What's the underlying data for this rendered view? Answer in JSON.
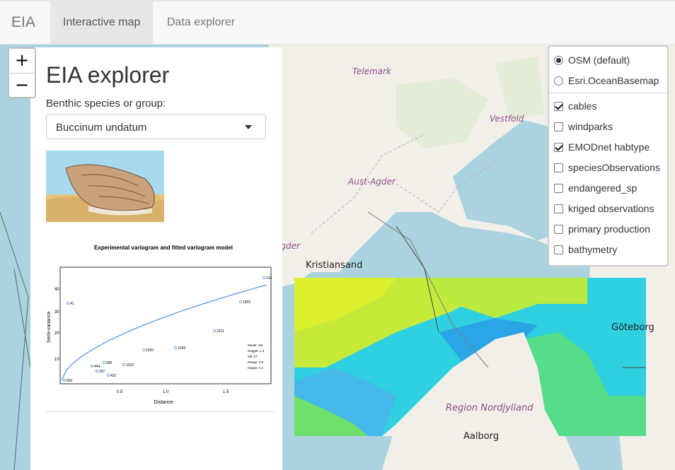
{
  "navbar": {
    "brand": "EIA",
    "tabs": [
      {
        "label": "Interactive map",
        "active": true
      },
      {
        "label": "Data explorer",
        "active": false
      }
    ]
  },
  "zoom": {
    "in": "+",
    "out": "−"
  },
  "panel": {
    "title": "EIA explorer",
    "species_label": "Benthic species or group:",
    "species_selected": "Buccinum undatum"
  },
  "variogram": {
    "title": "Experimental variogram and fitted variogram model",
    "xlabel": "Distance",
    "ylabel": "Semi-variance",
    "x_ticks": [
      "0.5",
      "1.0",
      "1.5"
    ],
    "y_ticks": [
      "10",
      "20",
      "30",
      "40"
    ],
    "legend": [
      "Model: Ste",
      "Nugget: 1.3",
      "Sill: 57",
      "Range: 3.9",
      "Kappa: 0.4"
    ],
    "point_labels": [
      "662",
      "444",
      "257",
      "580",
      "431",
      "1322",
      "41",
      "1020",
      "1293",
      "2211",
      "1955",
      "214"
    ]
  },
  "layers": {
    "base": [
      {
        "label": "OSM (default)",
        "checked": true
      },
      {
        "label": "Esri.OceanBasemap",
        "checked": false
      }
    ],
    "overlays": [
      {
        "label": "cables",
        "checked": true
      },
      {
        "label": "windparks",
        "checked": false
      },
      {
        "label": "EMODnet habtype",
        "checked": true
      },
      {
        "label": "speciesObservations",
        "checked": false
      },
      {
        "label": "endangered_sp",
        "checked": false
      },
      {
        "label": "kriged observations",
        "checked": false
      },
      {
        "label": "primary production",
        "checked": false
      },
      {
        "label": "bathymetry",
        "checked": false
      }
    ]
  },
  "map_labels": {
    "telemark": "Telemark",
    "vestfold": "Vestfold",
    "aust_agder": "Aust-Agder",
    "vest_agder": "Vest-Agder",
    "kristiansand": "Kristiansand",
    "goteborg": "Göteborg",
    "nordjylland": "Region Nordjylland",
    "aalborg": "Aalborg"
  },
  "colors": {
    "sea": "#aad3df",
    "land": "#f2efe9",
    "hab_yellow": "#d8ee2e",
    "hab_green": "#9be23a",
    "hab_cyan": "#2fd0e0",
    "hab_blue": "#2aa6e6"
  }
}
